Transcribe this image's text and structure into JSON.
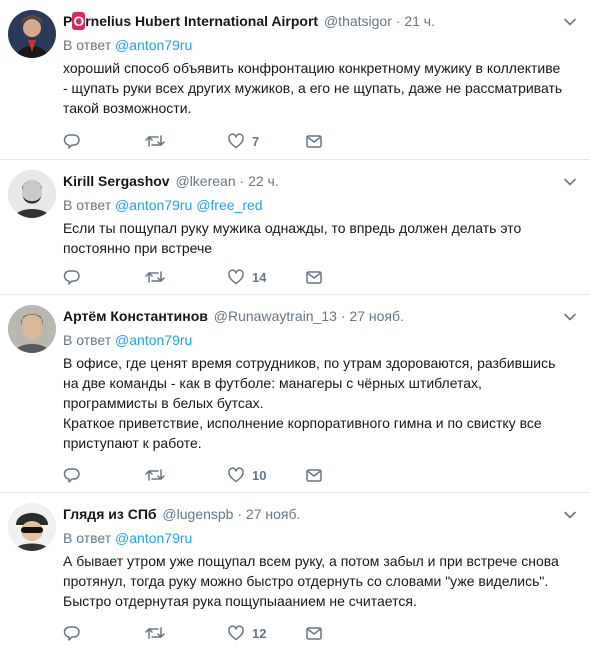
{
  "icons": {
    "reply": "reply-icon",
    "retweet": "retweet-icon",
    "like": "heart-icon",
    "message": "envelope-icon",
    "caret": "chevron-down-icon"
  },
  "colors": {
    "link": "#1da1f2",
    "muted": "#657786",
    "badge": "#e0245e"
  },
  "tweets": [
    {
      "name_prefix": "P",
      "name_badge": "O",
      "name_rest": "rnelius Hubert International Airport",
      "handle": "@thatsigor",
      "dot": "·",
      "time": "21 ч.",
      "reply_prefix": "В ответ",
      "reply_to": "@anton79ru",
      "reply_to_2": "",
      "text": [
        "хороший способ объявить конфронтацию конкретному мужику в коллективе - щупать руки всех других мужиков, а его не щупать, даже не рассматривать такой возможности."
      ],
      "likes": "7"
    },
    {
      "name": "Kirill Sergashov",
      "handle": "@lkerean",
      "dot": "·",
      "time": "22 ч.",
      "reply_prefix": "В ответ",
      "reply_to": "@anton79ru",
      "reply_to_2": "@free_red",
      "text": [
        "Если ты пощупал руку мужика однажды, то впредь должен делать это постоянно при встрече"
      ],
      "likes": "14"
    },
    {
      "name": "Артём Константинов",
      "handle": "@Runawaytrain_13",
      "dot": "·",
      "time": "27 нояб.",
      "reply_prefix": "В ответ",
      "reply_to": "@anton79ru",
      "reply_to_2": "",
      "text": [
        "В офисе, где ценят время сотрудников, по утрам здороваются, разбившись на две команды - как в футболе: манагеры с чёрных штиблетах, программисты в белых бутсах.",
        "Краткое приветствие, исполнение корпоративного гимна и по свистку все приступают к работе."
      ],
      "likes": "10"
    },
    {
      "name": "Глядя из СПб",
      "handle": "@lugenspb",
      "dot": "·",
      "time": "27 нояб.",
      "reply_prefix": "В ответ",
      "reply_to": "@anton79ru",
      "reply_to_2": "",
      "text": [
        "А бывает утром уже пощупал всем руку, а потом забыл и при встрече снова протянул, тогда руку можно быстро отдернуть со словами \"уже виделись\". Быстро отдернутая рука пощупыаанием не считается."
      ],
      "likes": "12"
    }
  ]
}
